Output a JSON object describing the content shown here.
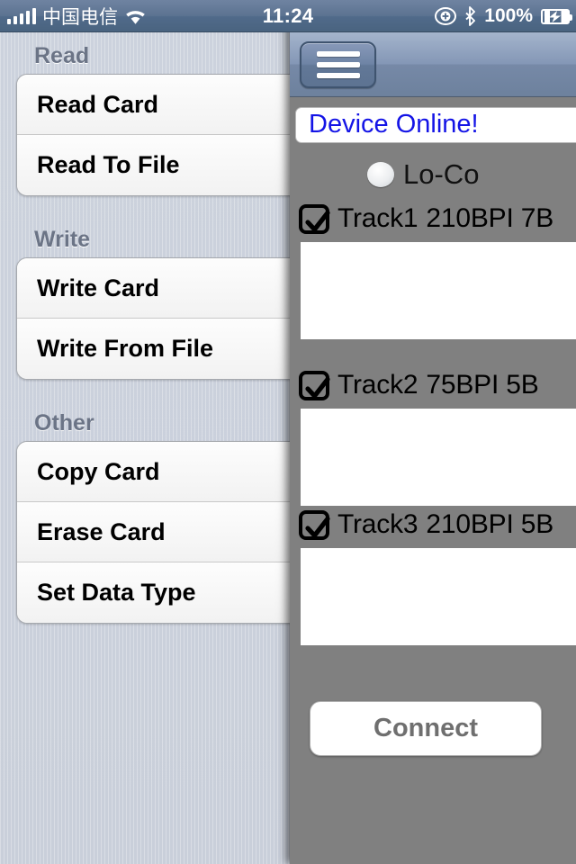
{
  "status_bar": {
    "carrier": "中国电信",
    "time": "11:24",
    "battery_percent": "100%",
    "signal_bars": 5,
    "icons": {
      "wifi": "wifi-icon",
      "rotation_lock": "rotation-lock-icon",
      "bluetooth": "bluetooth-icon",
      "battery": "battery-charging-icon"
    }
  },
  "sidebar": {
    "sections": [
      {
        "header": "Read",
        "items": [
          {
            "label": "Read Card"
          },
          {
            "label": "Read To File"
          }
        ]
      },
      {
        "header": "Write",
        "items": [
          {
            "label": "Write Card"
          },
          {
            "label": "Write From File"
          }
        ]
      },
      {
        "header": "Other",
        "items": [
          {
            "label": "Copy Card"
          },
          {
            "label": "Erase Card"
          },
          {
            "label": "Set Data Type"
          }
        ]
      }
    ]
  },
  "panel": {
    "menu_button": "menu-icon",
    "status_message": "Device Online!",
    "status_color": "#1414e6",
    "coercivity": {
      "label": "Lo-Co",
      "selected": false
    },
    "tracks": [
      {
        "name": "Track1",
        "spec": "210BPI 7B",
        "checked": true,
        "value": "",
        "placeholder": ""
      },
      {
        "name": "Track2",
        "spec": "75BPI 5B",
        "checked": true,
        "value": "",
        "placeholder": ""
      },
      {
        "name": "Track3",
        "spec": "210BPI 5B",
        "checked": true,
        "value": "",
        "placeholder": ""
      }
    ],
    "connect_button": "Connect"
  }
}
